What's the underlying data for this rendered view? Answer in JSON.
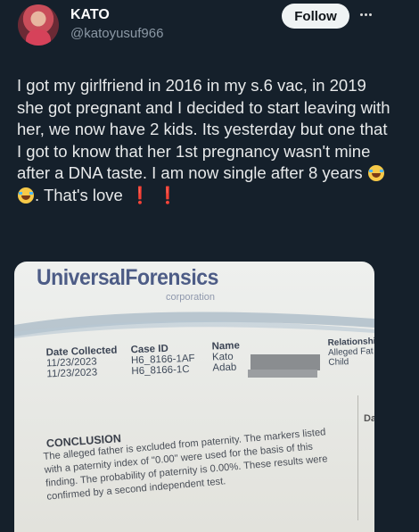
{
  "author": {
    "name": "KATO",
    "handle": "@katoyusuf966"
  },
  "actions": {
    "follow_label": "Follow",
    "more_icon": "more-horizontal-icon"
  },
  "tweet": {
    "text_part1": "I got my girlfriend in 2016 in my s.6 vac, in 2019 she got pregnant and I decided to start leaving with her, we now have 2 kids. Its yesterday but one that I got to know that her 1st pregnancy wasn't mine after a DNA taste. I am now single after 8 years ",
    "text_part2": ". That's love",
    "emoji": "crying-laughing-icon",
    "excl_1": "❗",
    "excl_2": "❗"
  },
  "document": {
    "logo": "UniversalForensics",
    "subtitle": "corporation",
    "headers": {
      "date": "Date Collected",
      "case": "Case ID",
      "name": "Name",
      "relationship": "Relationshi"
    },
    "rows": [
      {
        "date": "11/23/2023",
        "case": "H6_8166-1AF",
        "name": "Kato",
        "relationship": "Alleged Fat"
      },
      {
        "date": "11/23/2023",
        "case": "H6_8166-1C",
        "name": "Adab",
        "relationship": "Child"
      }
    ],
    "conclusion_title": "CONCLUSION",
    "conclusion_text": "The alleged father is excluded from paternity. The markers listed with a paternity index of \"0.00\" were used for the basis of this finding. The probability of paternity is 0.00%. These results were confirmed by a second independent test.",
    "edge_text": "Da"
  }
}
